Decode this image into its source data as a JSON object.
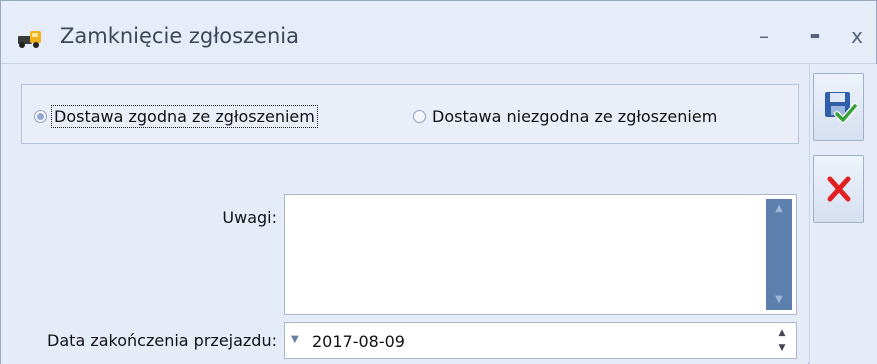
{
  "window": {
    "title": "Zamknięcie zgłoszenia",
    "minimize_glyph": "–",
    "maximize_glyph": "▬",
    "close_glyph": "x",
    "app_icon": "truck-icon"
  },
  "delivery_options": [
    {
      "label": "Dostawa zgodna ze zgłoszeniem",
      "checked": true
    },
    {
      "label": "Dostawa niezgodna ze zgłoszeniem",
      "checked": false
    }
  ],
  "form": {
    "notes_label": "Uwagi:",
    "notes_value": "",
    "date_label": "Data zakończenia przejazdu:",
    "date_value": "2017-08-09"
  },
  "actions": [
    {
      "name": "save-button",
      "icon": "save-check-icon"
    },
    {
      "name": "cancel-button",
      "icon": "red-x-icon"
    }
  ],
  "colors": {
    "accent": "#5d7fad",
    "cancel_red": "#e02020",
    "save_check_green": "#3aa03a"
  }
}
